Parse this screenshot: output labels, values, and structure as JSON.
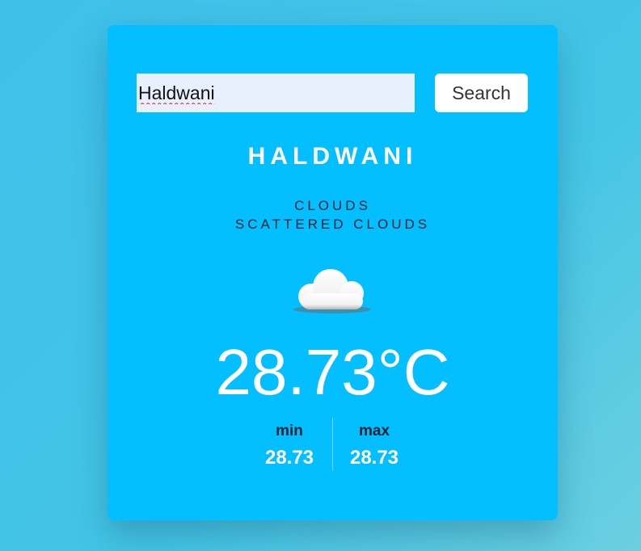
{
  "search": {
    "value": "Haldwani",
    "button_label": "Search"
  },
  "weather": {
    "city": "HALDWANI",
    "condition_main": "CLOUDS",
    "condition_desc": "SCATTERED CLOUDS",
    "icon": "cloud-icon",
    "temperature": "28.73°C",
    "min_label": "min",
    "min_value": "28.73",
    "max_label": "max",
    "max_value": "28.73"
  },
  "colors": {
    "card": "#03bfff",
    "background": "#44c5e6",
    "text_light": "#ffffff",
    "text_dark": "#0d2233"
  }
}
